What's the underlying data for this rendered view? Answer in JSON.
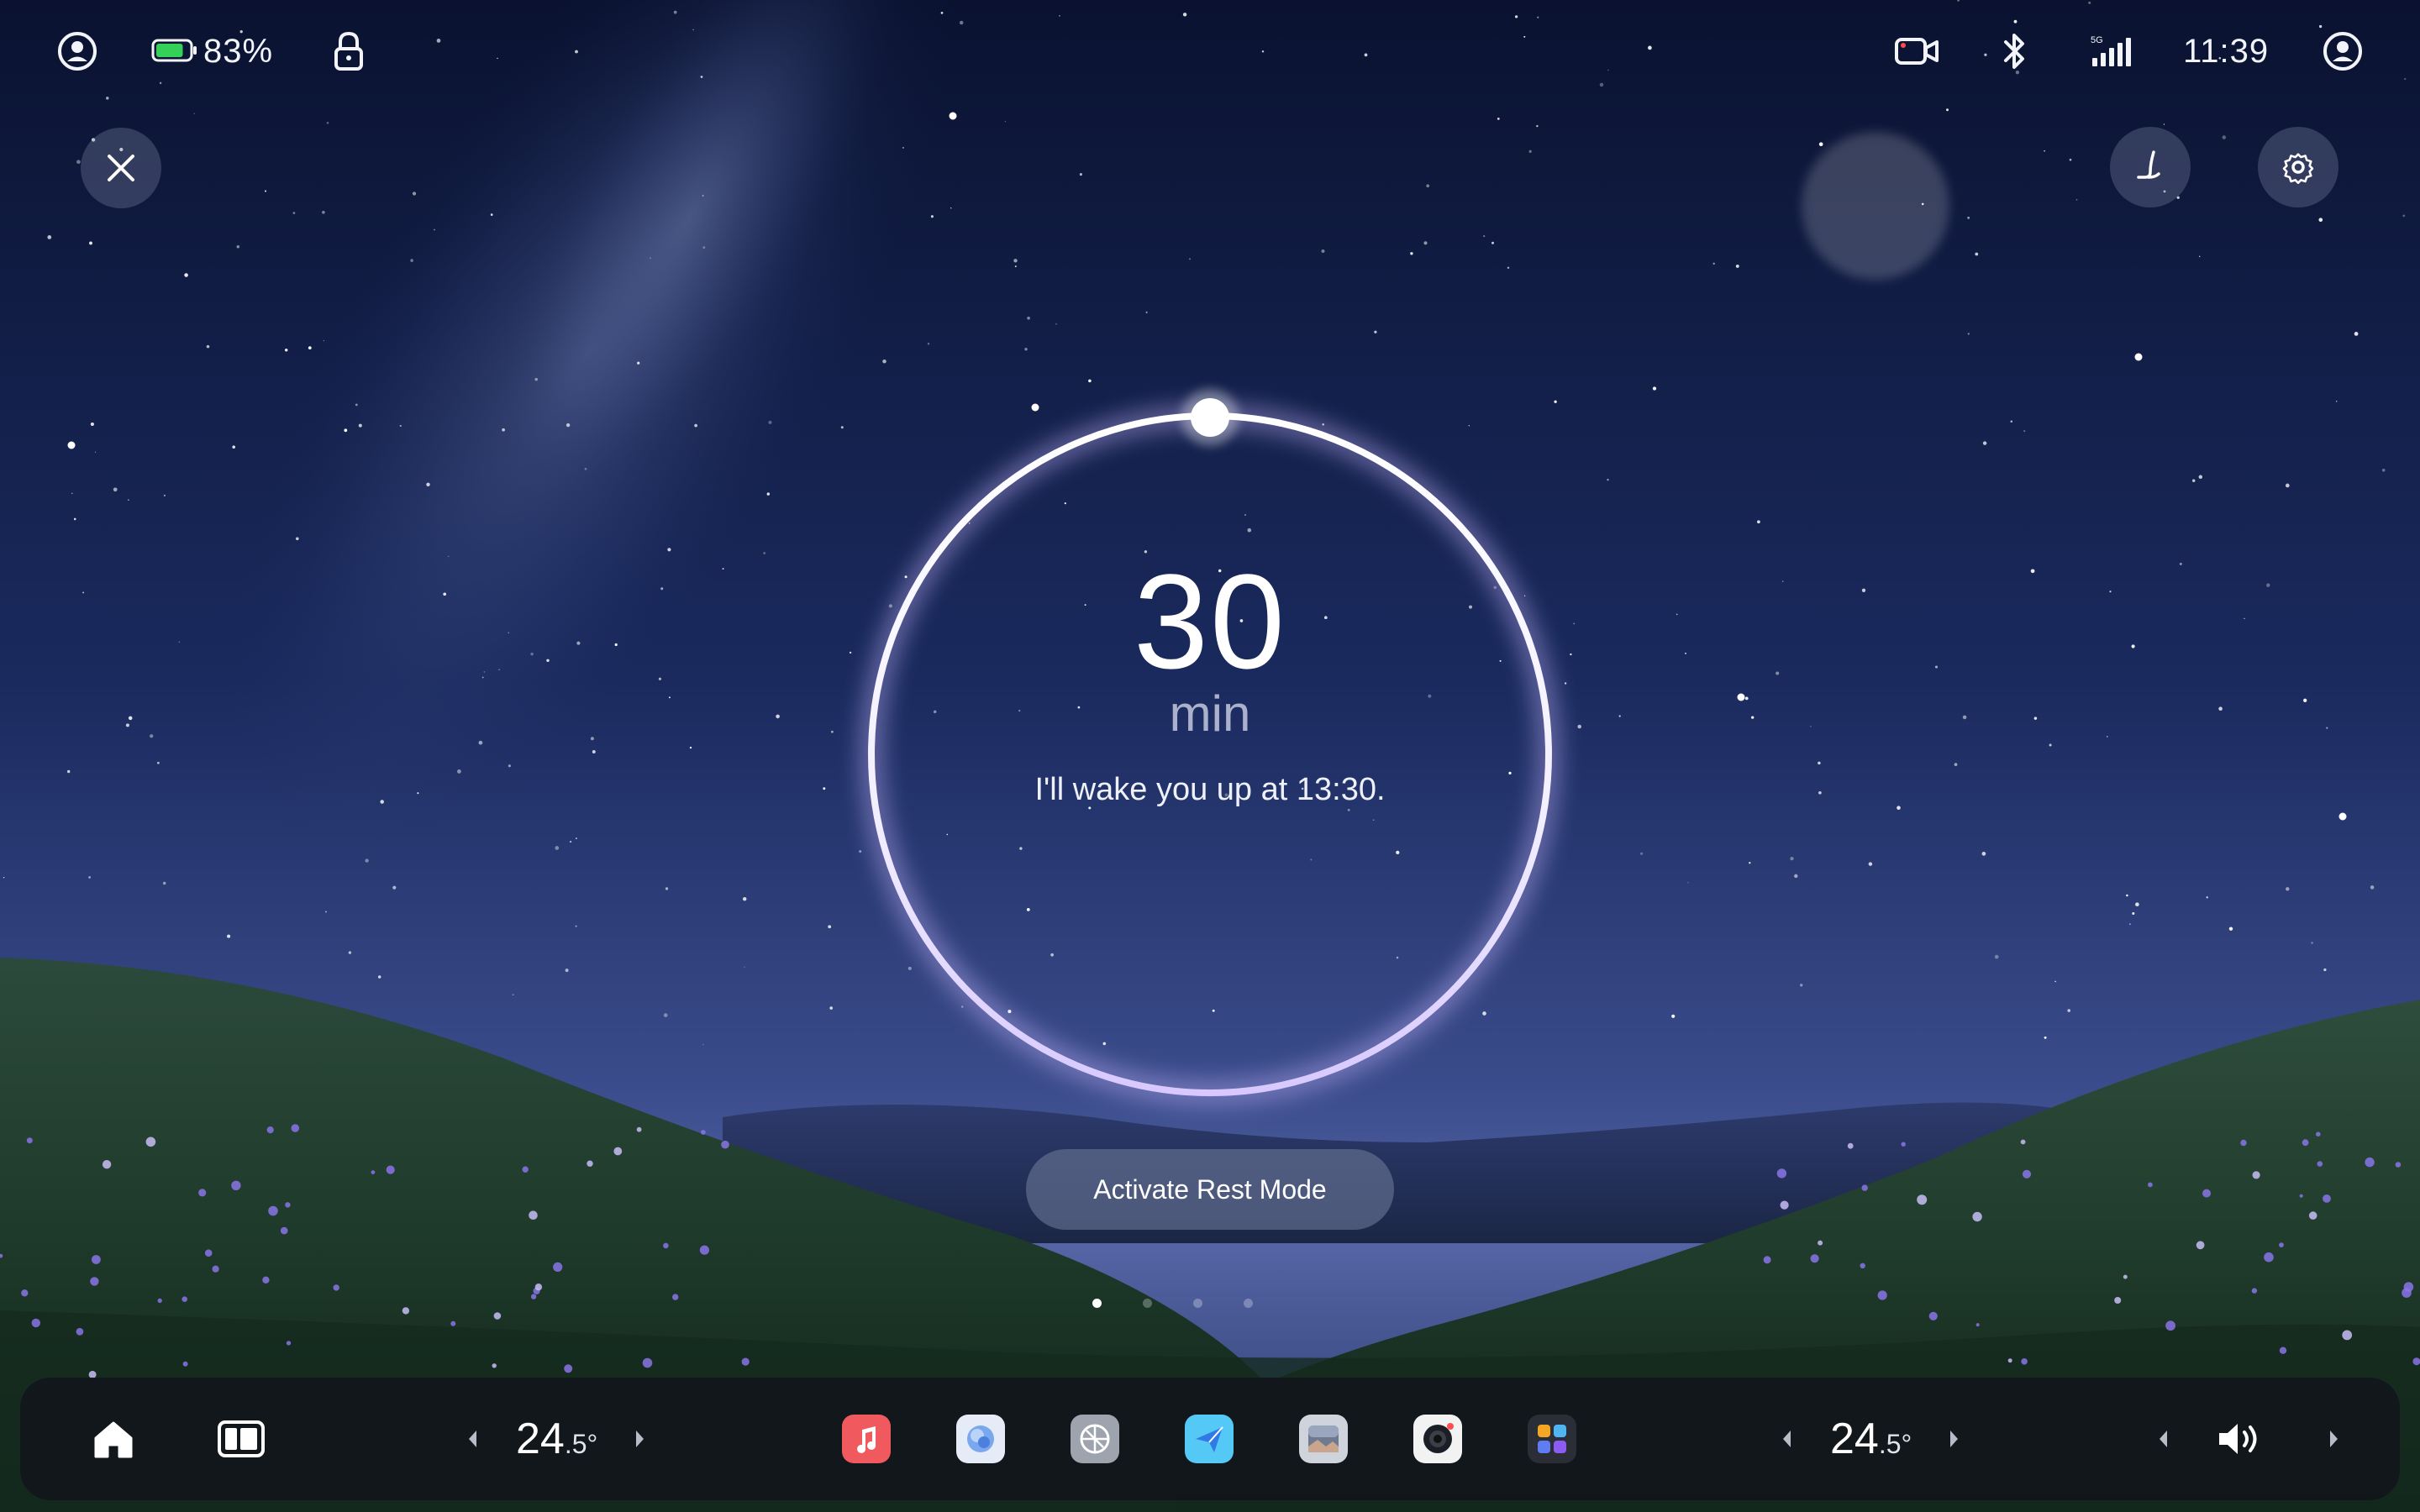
{
  "status_bar": {
    "battery_percent": "83%",
    "battery_level": 0.83,
    "network_type": "5G",
    "time": "11:39"
  },
  "timer": {
    "value": "30",
    "unit": "min",
    "wake_message": "I'll wake you up at 13:30."
  },
  "actions": {
    "activate_label": "Activate Rest Mode"
  },
  "pager": {
    "count": 4,
    "active_index": 0
  },
  "dock": {
    "left_temp": {
      "whole": "24",
      "decimal": ".5°"
    },
    "right_temp": {
      "whole": "24",
      "decimal": ".5°"
    },
    "apps": [
      {
        "name": "music-icon",
        "color": "#f05a5f"
      },
      {
        "name": "photos-icon",
        "color": "#e6ecf7"
      },
      {
        "name": "browser-icon",
        "color": "#9ea4ad"
      },
      {
        "name": "messages-icon",
        "color": "#55c9f5"
      },
      {
        "name": "gallery-icon",
        "color": "#ced3dc"
      },
      {
        "name": "camera-icon",
        "color": "#f2f2f2"
      },
      {
        "name": "apps-grid-icon",
        "color": "#2b2e36"
      }
    ]
  },
  "colors": {
    "sky_top": "#0b1330",
    "sky_horizon": "#4a5a9a",
    "ring_glow": "#b7a6ff",
    "battery_green": "#34d058"
  }
}
